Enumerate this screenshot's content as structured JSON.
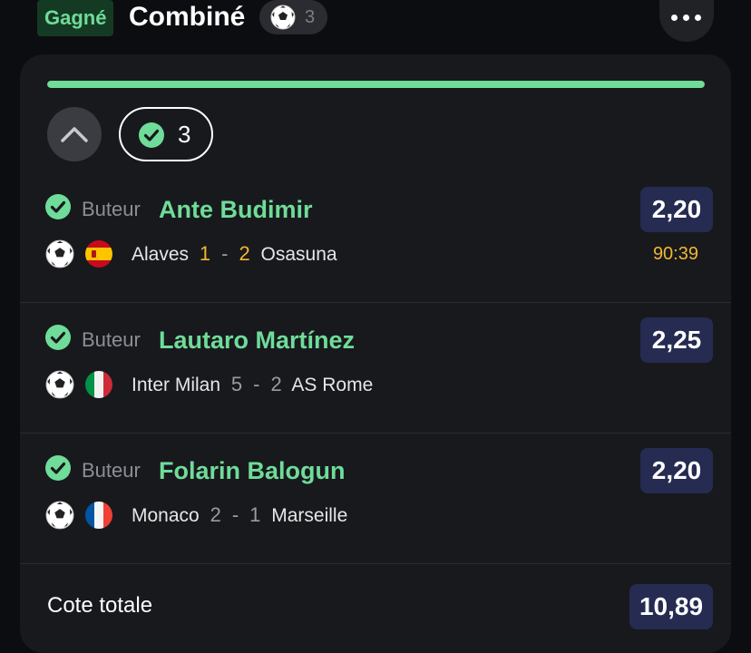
{
  "header": {
    "status": "Gagné",
    "title": "Combiné",
    "sport_icon": "soccer-ball-icon",
    "selection_count": "3",
    "more_icon": "more-horizontal-icon"
  },
  "card": {
    "progress": 1.0,
    "collapse_icon": "chevron-up-icon",
    "won_count": "3",
    "selections": [
      {
        "market": "Buteur",
        "player": "Ante Budimir",
        "odds": "2,20",
        "flag": "spain",
        "home": "Alaves",
        "home_score": "1",
        "sep": "-",
        "away_score": "2",
        "away": "Osasuna",
        "time": "90:39"
      },
      {
        "market": "Buteur",
        "player": "Lautaro Martínez",
        "odds": "2,25",
        "flag": "italy",
        "home": "Inter Milan",
        "home_score": "5",
        "sep": "-",
        "away_score": "2",
        "away": "AS Rome"
      },
      {
        "market": "Buteur",
        "player": "Folarin Balogun",
        "odds": "2,20",
        "flag": "france",
        "home": "Monaco",
        "home_score": "2",
        "sep": "-",
        "away_score": "1",
        "away": "Marseille"
      }
    ],
    "total_label": "Cote totale",
    "total_odds": "10,89"
  },
  "colors": {
    "accent_green": "#6fdc99",
    "live_yellow": "#f2b731",
    "odds_bg": "#262b52",
    "card_bg": "#18191d"
  }
}
